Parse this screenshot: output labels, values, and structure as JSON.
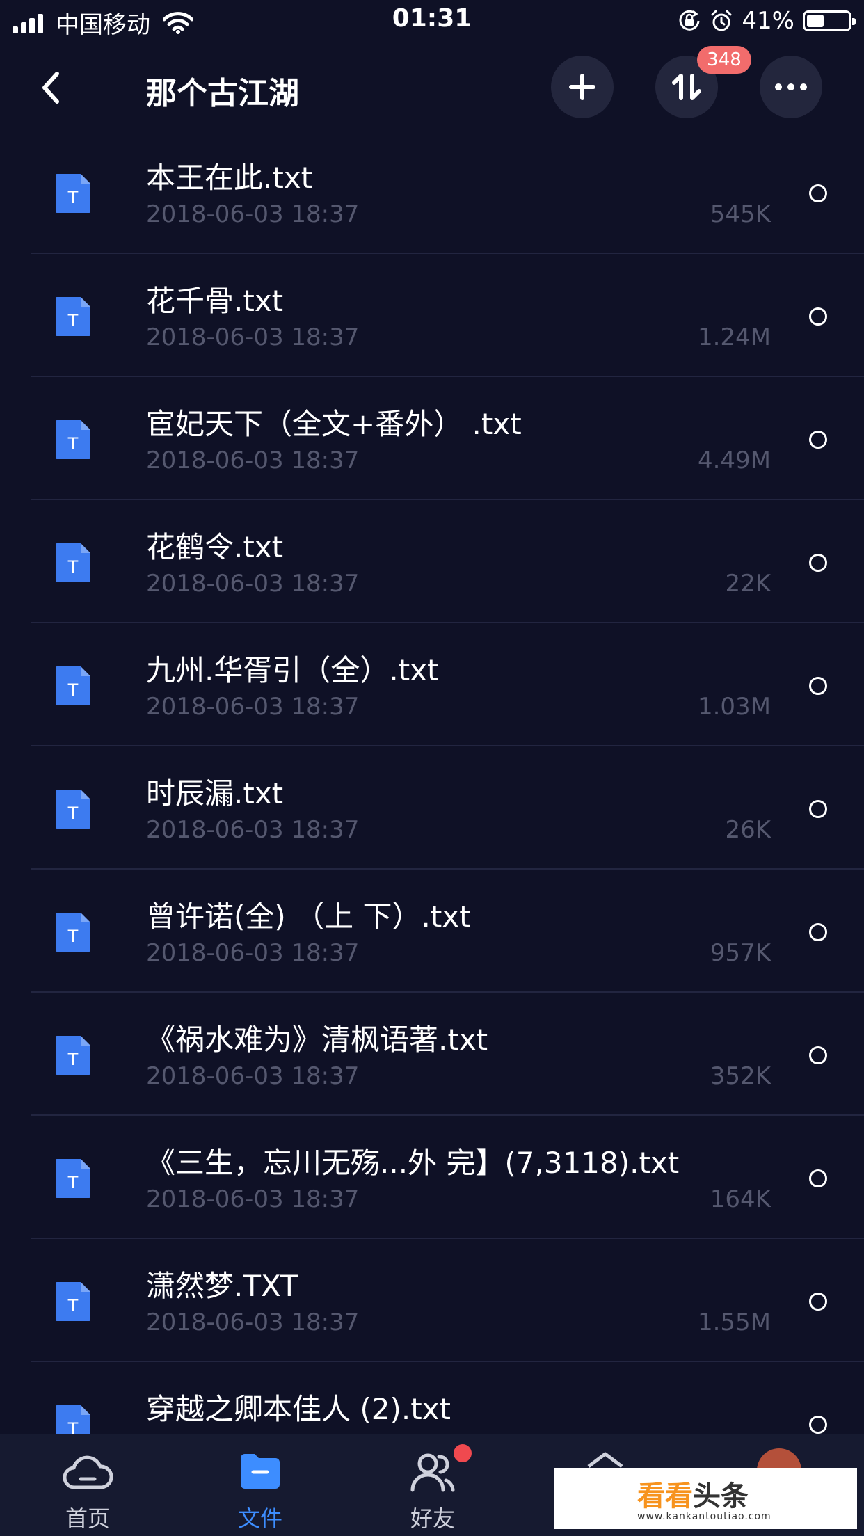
{
  "status_bar": {
    "carrier": "中国移动",
    "time": "01:31",
    "battery_percent": "41%",
    "battery_level": 0.41
  },
  "nav": {
    "title": "那个古江湖",
    "transfer_badge": "348"
  },
  "files": [
    {
      "name": "本王在此.txt",
      "date": "2018-06-03 18:37",
      "size": "545K"
    },
    {
      "name": "花千骨.txt",
      "date": "2018-06-03 18:37",
      "size": "1.24M"
    },
    {
      "name": "宦妃天下（全文+番外） .txt",
      "date": "2018-06-03 18:37",
      "size": "4.49M"
    },
    {
      "name": "花鹤令.txt",
      "date": "2018-06-03 18:37",
      "size": "22K"
    },
    {
      "name": "九州.华胥引（全）.txt",
      "date": "2018-06-03 18:37",
      "size": "1.03M"
    },
    {
      "name": "时辰漏.txt",
      "date": "2018-06-03 18:37",
      "size": "26K"
    },
    {
      "name": "曾许诺(全) （上 下）.txt",
      "date": "2018-06-03 18:37",
      "size": "957K"
    },
    {
      "name": "《祸水难为》清枫语著.txt",
      "date": "2018-06-03 18:37",
      "size": "352K"
    },
    {
      "name": "《三生，忘川无殇...外 完】(7,3118).txt",
      "date": "2018-06-03 18:37",
      "size": "164K"
    },
    {
      "name": "潇然梦.TXT",
      "date": "2018-06-03 18:37",
      "size": "1.55M"
    },
    {
      "name": "穿越之卿本佳人 (2).txt",
      "date": "",
      "size": ""
    }
  ],
  "file_icon_letter": "T",
  "tabs": [
    {
      "label": "首页",
      "icon": "cloud-icon"
    },
    {
      "label": "文件",
      "icon": "folder-icon"
    },
    {
      "label": "好友",
      "icon": "friends-icon"
    }
  ],
  "watermark": {
    "text_a": "看看",
    "text_b": "头条",
    "url": "www.kankantoutiao.com"
  },
  "colors": {
    "background": "#0f1126",
    "accent": "#3d8dff",
    "badge": "#f26c6c",
    "doc_icon": "#3d7bf0"
  }
}
